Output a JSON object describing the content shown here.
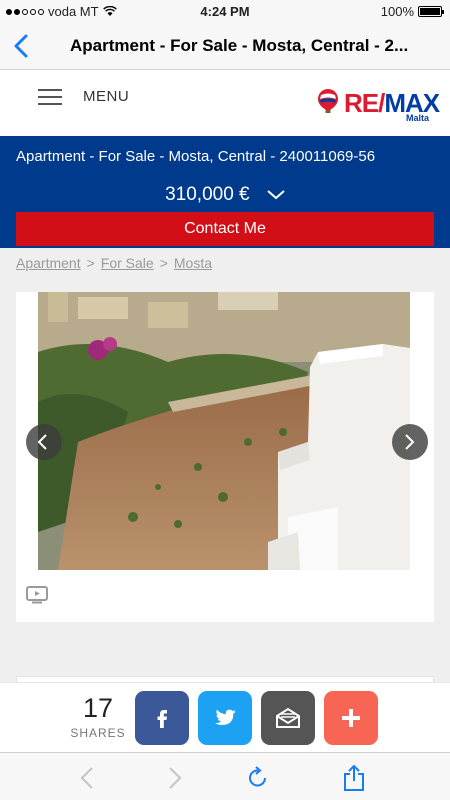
{
  "status": {
    "carrier": "voda MT",
    "time": "4:24 PM",
    "battery": "100%",
    "signal_bars_filled": 2,
    "signal_bars_total": 5
  },
  "nav": {
    "title": "Apartment - For Sale - Mosta, Central - 2..."
  },
  "header": {
    "menu_label": "MENU",
    "logo_text_red": "RE/",
    "logo_text_blue": "MAX",
    "logo_sub": "Malta"
  },
  "listing": {
    "title": "Apartment - For Sale - Mosta, Central - 240011069-56",
    "price": "310,000 €",
    "contact_label": "Contact Me"
  },
  "breadcrumb": {
    "items": [
      "Apartment",
      "For Sale",
      "Mosta"
    ],
    "separator": ">"
  },
  "share": {
    "count": "17",
    "label": "SHARES"
  },
  "colors": {
    "brand_blue": "#003a8c",
    "contact_red": "#d20f16",
    "facebook": "#3b5998",
    "twitter": "#1da1f2",
    "email": "#555555",
    "more": "#f76554",
    "ios_blue": "#1a7cf5"
  },
  "icons": [
    "back-chevron-icon",
    "wifi-icon",
    "hamburger-icon",
    "remax-balloon-icon",
    "chevron-down-icon",
    "arrow-left-icon",
    "arrow-right-icon",
    "video-tv-icon",
    "facebook-icon",
    "twitter-icon",
    "email-icon",
    "plus-icon",
    "browser-back-icon",
    "browser-forward-icon",
    "reload-icon",
    "share-icon"
  ]
}
